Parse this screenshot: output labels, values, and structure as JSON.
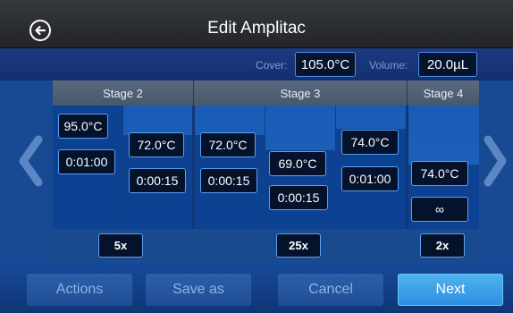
{
  "header": {
    "title": "Edit Amplitac",
    "back_icon": "back-arrow-icon"
  },
  "settings": {
    "cover_label": "Cover:",
    "cover_value": "105.0°C",
    "volume_label": "Volume:",
    "volume_value": "20.0µL"
  },
  "stages": [
    {
      "label": "Stage 2",
      "cycles": "5x"
    },
    {
      "label": "Stage 3",
      "cycles": "25x"
    },
    {
      "label": "Stage 4",
      "cycles": "2x"
    }
  ],
  "steps": [
    {
      "temp": "95.0°C",
      "time": "0:01:00"
    },
    {
      "temp": "72.0°C",
      "time": "0:00:15"
    },
    {
      "temp": "72.0°C",
      "time": "0:00:15"
    },
    {
      "temp": "69.0°C",
      "time": "0:00:15"
    },
    {
      "temp": "74.0°C",
      "time": "0:01:00"
    },
    {
      "temp": "74.0°C",
      "time": "∞"
    }
  ],
  "footer": {
    "actions": "Actions",
    "save_as": "Save as",
    "cancel": "Cancel",
    "next": "Next"
  },
  "icons": {
    "left": "chevron-left-icon",
    "right": "chevron-right-icon"
  },
  "colors": {
    "accent": "#4fb3f0",
    "panel_blue": "#1b52a0",
    "box_border": "#5ba0f0"
  }
}
